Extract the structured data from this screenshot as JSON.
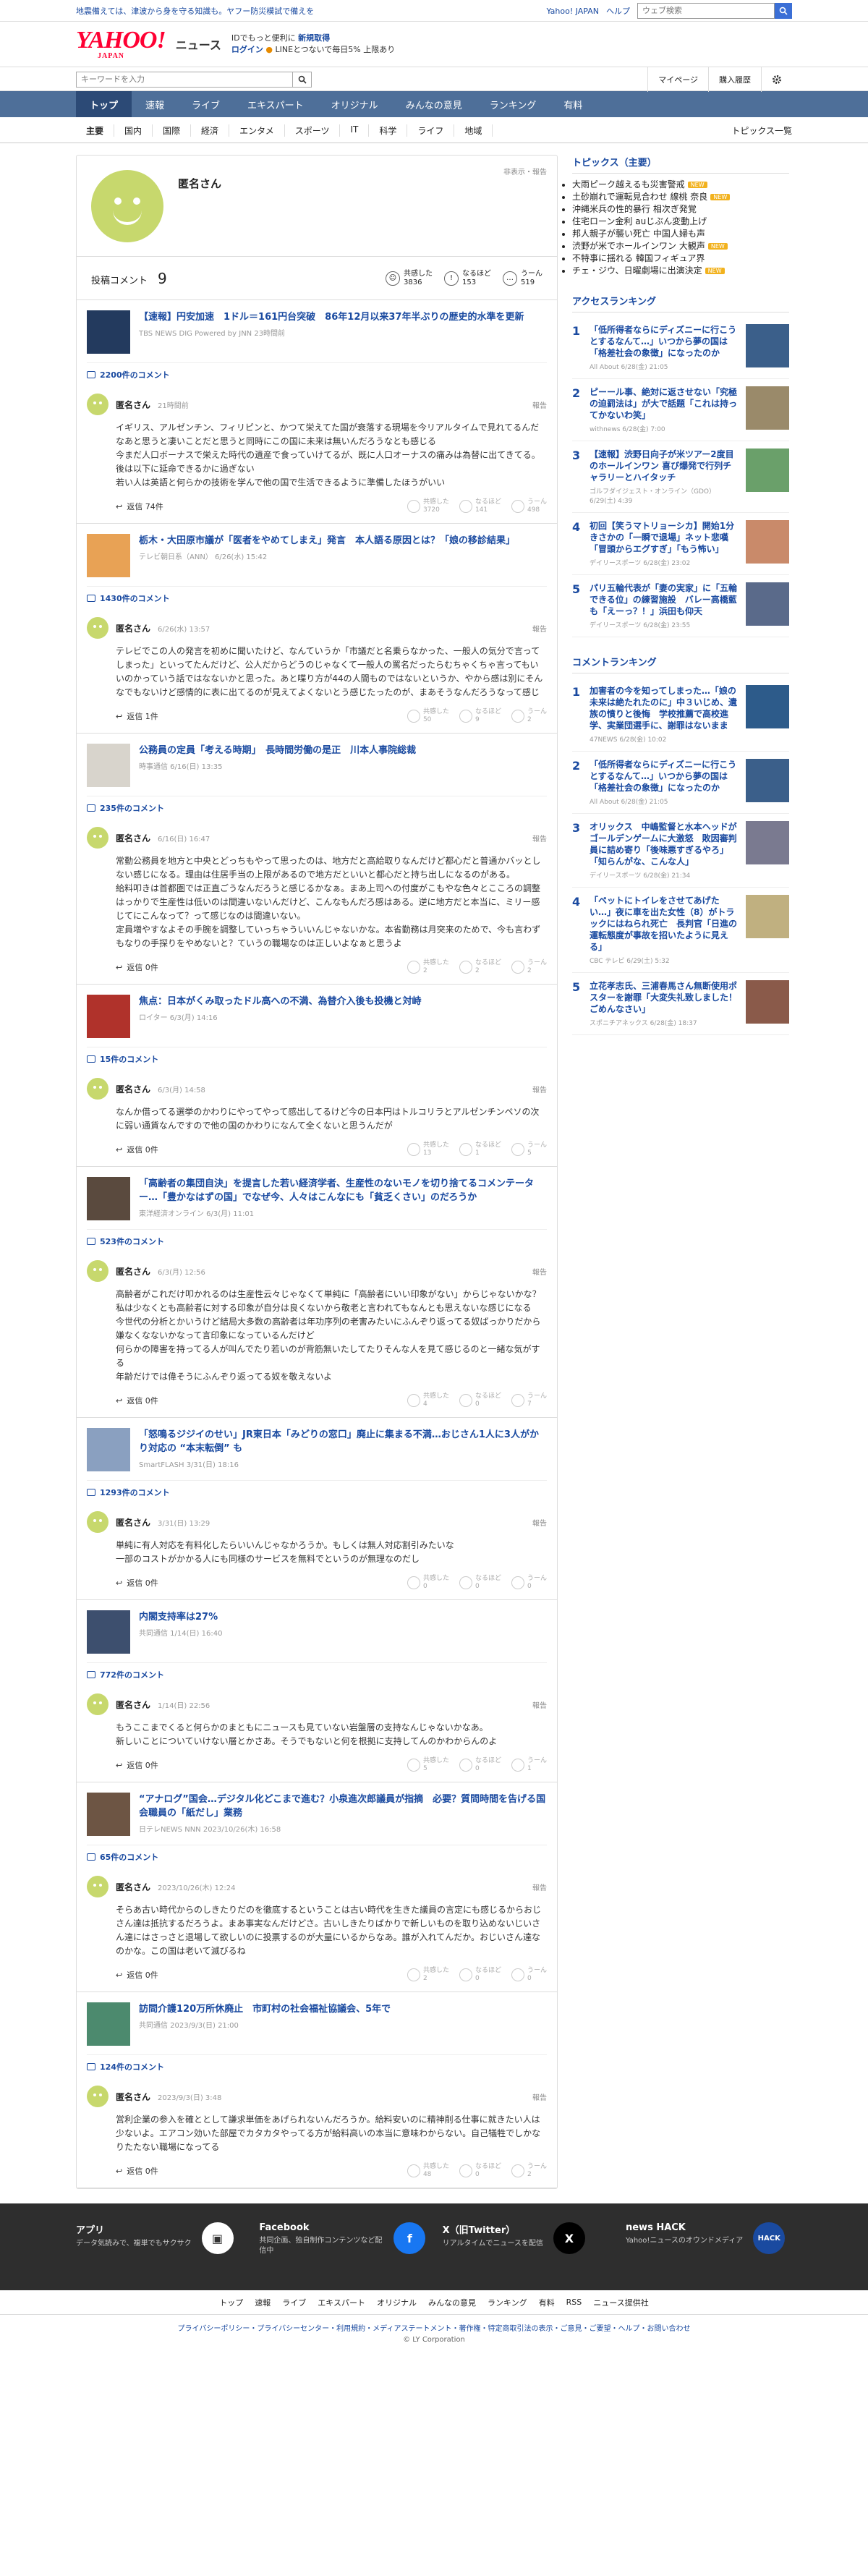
{
  "topstrip": {
    "notice": "地震備えては、津波から身を守る知識も。ヤフー防災模試で備えを",
    "links": [
      "Yahoo! JAPAN",
      "ヘルプ"
    ],
    "search_placeholder": "ウェブ検索"
  },
  "header": {
    "logo": "YAHOO!",
    "logo_sub": "JAPAN",
    "site": "ニュース",
    "login_line1": "IDでもっと便利に",
    "login_line1_link": "新規取得",
    "login_line2_link": "ログイン",
    "login_line2": "LINEとつないで毎日5% 上限あり"
  },
  "search": {
    "placeholder": "キーワードを入力",
    "links": [
      "マイページ",
      "購入履歴"
    ]
  },
  "mainnav": [
    "トップ",
    "速報",
    "ライブ",
    "エキスパート",
    "オリジナル",
    "みんなの意見",
    "ランキング",
    "有料"
  ],
  "subnav": {
    "items": [
      "主要",
      "国内",
      "国際",
      "経済",
      "エンタメ",
      "スポーツ",
      "IT",
      "科学",
      "ライフ",
      "地域"
    ],
    "all": "トピックス一覧"
  },
  "profile": {
    "name": "匿名さん",
    "hidden_label": "非表示・報告",
    "comments_label": "投稿コメント",
    "comments_count": "9",
    "reactions": [
      {
        "label": "共感した",
        "count": "3836"
      },
      {
        "label": "なるほど",
        "count": "153"
      },
      {
        "label": "うーん",
        "count": "519"
      }
    ]
  },
  "labels": {
    "report": "報告",
    "reply": "返信",
    "empathy": "共感した",
    "naruhodo": "なるほど",
    "hmm": "うーん"
  },
  "entries": [
    {
      "title": "【速報】円安加速　1ドル＝161円台突破　86年12月以来37年半ぶりの歴史的水準を更新",
      "source": "TBS NEWS DIG Powered by JNN 23時間前",
      "comment_count": "2200件のコメント",
      "user": "匿名さん",
      "time": "21時間前",
      "text": "イギリス、アルゼンチン、フィリピンと、かつて栄えてた国が衰落する現場を今リアルタイムで見れてるんだなあと思うと凄いことだと思うと同時にこの国に未来は無いんだろうなとも感じる\n今まだ人口ボーナスで栄えた時代の遺産で食っていけてるが、既に人口オーナスの痛みは為替に出てきてる。後は以下に延命できるかに過ぎない\n若い人は英語と何らかの技術を学んで他の国で生活できるように準備したほうがいい",
      "reply": "返信 74件",
      "r1": "3720",
      "r2": "141",
      "r3": "498",
      "thumb": "#233a5e"
    },
    {
      "title": "栃木・大田原市議が「医者をやめてしまえ」発言　本人語る原因とは？「娘の移診結果」",
      "source": "テレビ朝日系（ANN） 6/26(水) 15:42",
      "comment_count": "1430件のコメント",
      "user": "匿名さん",
      "time": "6/26(水) 13:57",
      "text": "テレビでこの人の発言を初めに聞いたけど、なんていうか「市議だと名乗らなかった、一般人の気分で言ってしまった」といってたんだけど、公人だからどうのじゃなくて一般人の罵名だったらむちゃくちゃ言ってもいいのかっていう話ではなないかと思った。あと喋り方が44の人間ものではないというか、やから感は別にそんなでもないけど感情的に表に出てるのが見えてよくないとう感じたったのが、まあそうなんだろうなって感じ",
      "reply": "返信 1件",
      "r1": "50",
      "r2": "9",
      "r3": "2",
      "thumb": "#e8a255"
    },
    {
      "title": "公務員の定員「考える時期」　長時間労働の是正　川本人事院総裁",
      "source": "時事通信 6/16(日) 13:35",
      "comment_count": "235件のコメント",
      "user": "匿名さん",
      "time": "6/16(日) 16:47",
      "text": "常勤公務員を地方と中央とどっちもやって思ったのは、地方だと高給取りなんだけど都心だと普通かバッとしない感じになる。理由は住居手当の上限があるので地方だといいと都心だと持ち出しになるのがある。\n給料叩きは首都圏では正直ごうなんだろうと感じるかなぁ。まあ上司への付度がこもやな色々とこころの調整はっかりで生産性は低いのは間違いないんだけど、こんなもんだろ感はある。逆に地方だと本当に、ミリー感じてにこんなって？って感じなのは間違いない。\n定員増やすなよその手腕を調整していっちゃういいんじゃないかな。本省勤務は月突来のためで、今も言わずもなりの手探りをやめないと？ていうの職場なのは正しいよなぁと思うよ",
      "reply": "返信 0件",
      "r1": "2",
      "r2": "2",
      "r3": "2",
      "thumb": "#d8d4cc"
    },
    {
      "title": "焦点：日本がくみ取ったドル高への不満、為替介入後も投機と対峙",
      "source": "ロイター 6/3(月) 14:16",
      "comment_count": "15件のコメント",
      "user": "匿名さん",
      "time": "6/3(月) 14:58",
      "text": "なんか借ってる選挙のかわりにやってやって感出してるけど今の日本円はトルコリラとアルゼンチンペソの次に弱い通貨なんですので他の国のかわりになんて全くないと思うんだが",
      "reply": "返信 0件",
      "r1": "13",
      "r2": "1",
      "r3": "5",
      "thumb": "#b0322b"
    },
    {
      "title": "「高齢者の集団自決」を提言した若い経済学者、生産性のないモノを切り捨てるコメンテーター…「豊かなはずの国」でなぜ今、人々はこんなにも「貧乏くさい」のだろうか",
      "source": "東洋経済オンライン 6/3(月) 11:01",
      "comment_count": "523件のコメント",
      "user": "匿名さん",
      "time": "6/3(月) 12:56",
      "text": "高齢者がこれだけ叩かれるのは生産性云々じゃなくて単純に「高齢者にいい印象がない」からじゃないかな？\n私は少なくとも高齢者に対する印象が自分は良くないから敬老と言われてもなんとも思えないな感じになる\n今世代の分析とかいうけど結局大多数の高齢者は年功序列の老害みたいにふんぞり返ってる奴ばっかりだから嫌なくなないかなって言印象になっているんだけど\n何らかの障害を持ってる人が叫んでたり若いのが背筋無いたしてたりそんな人を見て感じるのと一緒な気がする\n年齢だけでは偉そうにふんぞり返ってる奴を敬えないよ",
      "reply": "返信 0件",
      "r1": "4",
      "r2": "0",
      "r3": "7",
      "thumb": "#5a4a3e"
    },
    {
      "title": "「怒鳴るジジイのせい」JR東日本「みどりの窓口」廃止に集まる不満…おじさん1人に3人がかり対応の “本末転倒” も",
      "source": "SmartFLASH 3/31(日) 18:16",
      "comment_count": "1293件のコメント",
      "user": "匿名さん",
      "time": "3/31(日) 13:29",
      "text": "単純に有人対応を有料化したらいいんじゃなかろうか。もしくは無人対応割引みたいな\n一部のコストがかかる人にも同様のサービスを無料でというのが無理なのだし",
      "reply": "返信 0件",
      "r1": "0",
      "r2": "0",
      "r3": "0",
      "thumb": "#8aa0c0"
    },
    {
      "title": "内閣支持率は27%",
      "source": "共同通信 1/14(日) 16:40",
      "comment_count": "772件のコメント",
      "user": "匿名さん",
      "time": "1/14(日) 22:56",
      "text": "もうここまでくると何らかのまともにニュースも見ていない岩盤層の支持なんじゃないかなあ。\n新しいことについていけない層とかさあ。そうでもないと何を根拠に支持してんのかわからんのよ",
      "reply": "返信 0件",
      "r1": "5",
      "r2": "0",
      "r3": "1",
      "thumb": "#3d4f6e"
    },
    {
      "title": "“アナログ”国会…デジタル化どこまで進む？小泉進次郎議員が指摘　必要？質問時間を告げる国会職員の「紙だし」業務",
      "source": "日テレNEWS NNN 2023/10/26(木) 16:58",
      "comment_count": "65件のコメント",
      "user": "匿名さん",
      "time": "2023/10/26(木) 12:24",
      "text": "そらあ古い時代からのしきたりだのを徹底するということは古い時代を生きた議員の言定にも感じるからおじさん達は抵抗するだろうよ。まあ事実なんだけどさ。古いしきたりばかりで新しいものを取り込めないじいさん達にはさっさと退場して欲しいのに投票するのが大量にいるからなあ。誰が入れてんだか。おじいさん達なのかな。この国は老いて滅びるね",
      "reply": "返信 0件",
      "r1": "2",
      "r2": "0",
      "r3": "0",
      "thumb": "#6d5544"
    },
    {
      "title": "訪問介護120万所休廃止　市町村の社会福祉協議会、5年で",
      "source": "共同通信 2023/9/3(日) 21:00",
      "comment_count": "124件のコメント",
      "user": "匿名さん",
      "time": "2023/9/3(日) 3:48",
      "text": "営利企業の参入を確ととして謙求単価をあげられないんだろうか。給料安いのに精神削る仕事に就きたい人は少ないよ。エアコン効いた部屋でカタカタやってる方が給料高いの本当に意味わからない。自己犠牲でしかなりたたない職場になってる",
      "reply": "返信 0件",
      "r1": "48",
      "r2": "0",
      "r3": "2",
      "thumb": "#4c8a6e"
    }
  ],
  "sidebar": {
    "topics_title": "トピックス（主要）",
    "topics": [
      {
        "text": "大雨ピーク越えるも災害警戒",
        "new": true
      },
      {
        "text": "土砂崩れで運転見合わせ 線桃 奈良",
        "new": true
      },
      {
        "text": "沖縄米兵の性的暴行 相次ぎ発覚",
        "new": false
      },
      {
        "text": "住宅ローン金利 auじぶん変動上げ",
        "new": false
      },
      {
        "text": "邦人親子が襲い死亡 中国人婦も声",
        "new": false
      },
      {
        "text": "渋野が米でホールインワン 大観声",
        "new": true
      },
      {
        "text": "不特事に揺れる 韓国フィギュア界",
        "new": false
      },
      {
        "text": "チェ・ジウ、日曜劇場に出演決定",
        "new": true
      }
    ],
    "new_label": "NEW",
    "access_title": "アクセスランキング",
    "access": [
      {
        "n": "1",
        "t": "「低所得者ならにディズニーに行こうとするなんて…」いつから夢の国は「格差社会の象徴」になったのか",
        "s": "All About 6/28(金) 21:05",
        "c": "#3b5f8a"
      },
      {
        "n": "2",
        "t": "ピーール事、絶対に返させない「究極の迫罰法は」が大で話題「これは持ってかないわ笑」",
        "s": "withnews 6/28(金) 7:00",
        "c": "#9a8a6a"
      },
      {
        "n": "3",
        "t": "【速報】渋野日向子が米ツアー2度目のホールインワン 喜び爆発で行列チャラリーとハイタッチ",
        "s": "ゴルフダイジェスト・オンライン（GDO） 6/29(土) 4:39",
        "c": "#6aa06a"
      },
      {
        "n": "4",
        "t": "初回【笑うマトリョーシカ】開始1分きさかの「一瞬で退場」ネット悲嘆「冒頭からエグすぎ」「もう怖い」",
        "s": "デイリースポーツ 6/28(金) 23:02",
        "c": "#c98a6a"
      },
      {
        "n": "5",
        "t": "パリ五輪代表が「妻の実家」に「五輪できる位」の練習施設　バレー高橋藍も「えーっ？！」浜田も仰天",
        "s": "デイリースポーツ 6/28(金) 23:55",
        "c": "#5a6a8a"
      }
    ],
    "comment_title": "コメントランキング",
    "comment": [
      {
        "n": "1",
        "t": "加害者の今を知ってしまった…「娘の未来は絶たれたのに」中３いじめ、遺族の憤りと後悔　学校推薦で高校進学、実業団選手に、謝罪はないまま",
        "s": "47NEWS 6/28(金) 10:02",
        "c": "#2d5b8a"
      },
      {
        "n": "2",
        "t": "「低所得者ならにディズニーに行こうとするなんて…」いつから夢の国は「格差社会の象徴」になったのか",
        "s": "All About 6/28(金) 21:05",
        "c": "#3b5f8a"
      },
      {
        "n": "3",
        "t": "オリックス　中嶋監督と水本ヘッドがゴールデンゲームに大激怒　敗因審判員に詰め寄り「後味悪すぎるやろ」「知らんがな、こんな人」",
        "s": "デイリースポーツ 6/28(金) 21:34",
        "c": "#7a7a90"
      },
      {
        "n": "4",
        "t": "「ペットにトイレをさせてあげたい…」夜に車を出た女性（8）がトラックにはねられ死亡　長判官「日進の運転態度が事故を招いたように見える」",
        "s": "CBC テレビ 6/29(土) 5:32",
        "c": "#c0b080"
      },
      {
        "n": "5",
        "t": "立花孝志氏、三浦春馬さん無断使用ポスターを謝罪「大変失礼致しました！ごめんなさい」",
        "s": "スポニチアネックス 6/28(金) 18:37",
        "c": "#8a5a4a"
      }
    ]
  },
  "footer": {
    "apps": [
      {
        "title": "アプリ",
        "desc": "データ気読みで、複単でもサクサク",
        "badge": "▣",
        "color": "#ffffff"
      },
      {
        "title": "Facebook",
        "desc": "共同企画、独自制作コンテンツなど配信中",
        "badge": "f",
        "color": "#1877f2"
      },
      {
        "title": "X（旧Twitter）",
        "desc": "リアルタイムでニュースを配信",
        "badge": "X",
        "color": "#000000"
      },
      {
        "title": "news HACK",
        "desc": "Yahoo!ニュースのオウンドメディア",
        "badge": "HACK",
        "color": "#1a4aa0"
      }
    ],
    "nav": [
      "トップ",
      "速報",
      "ライブ",
      "エキスパート",
      "オリジナル",
      "みんなの意見",
      "ランキング",
      "有料",
      "RSS",
      "ニュース提供社"
    ],
    "legal": "プライバシーポリシー・プライバシーセンター・利用規約・メディアステートメント・著作権・特定商取引法の表示・ご意見・ご要望・ヘルプ・お問い合わせ",
    "copyright": "© LY Corporation"
  }
}
